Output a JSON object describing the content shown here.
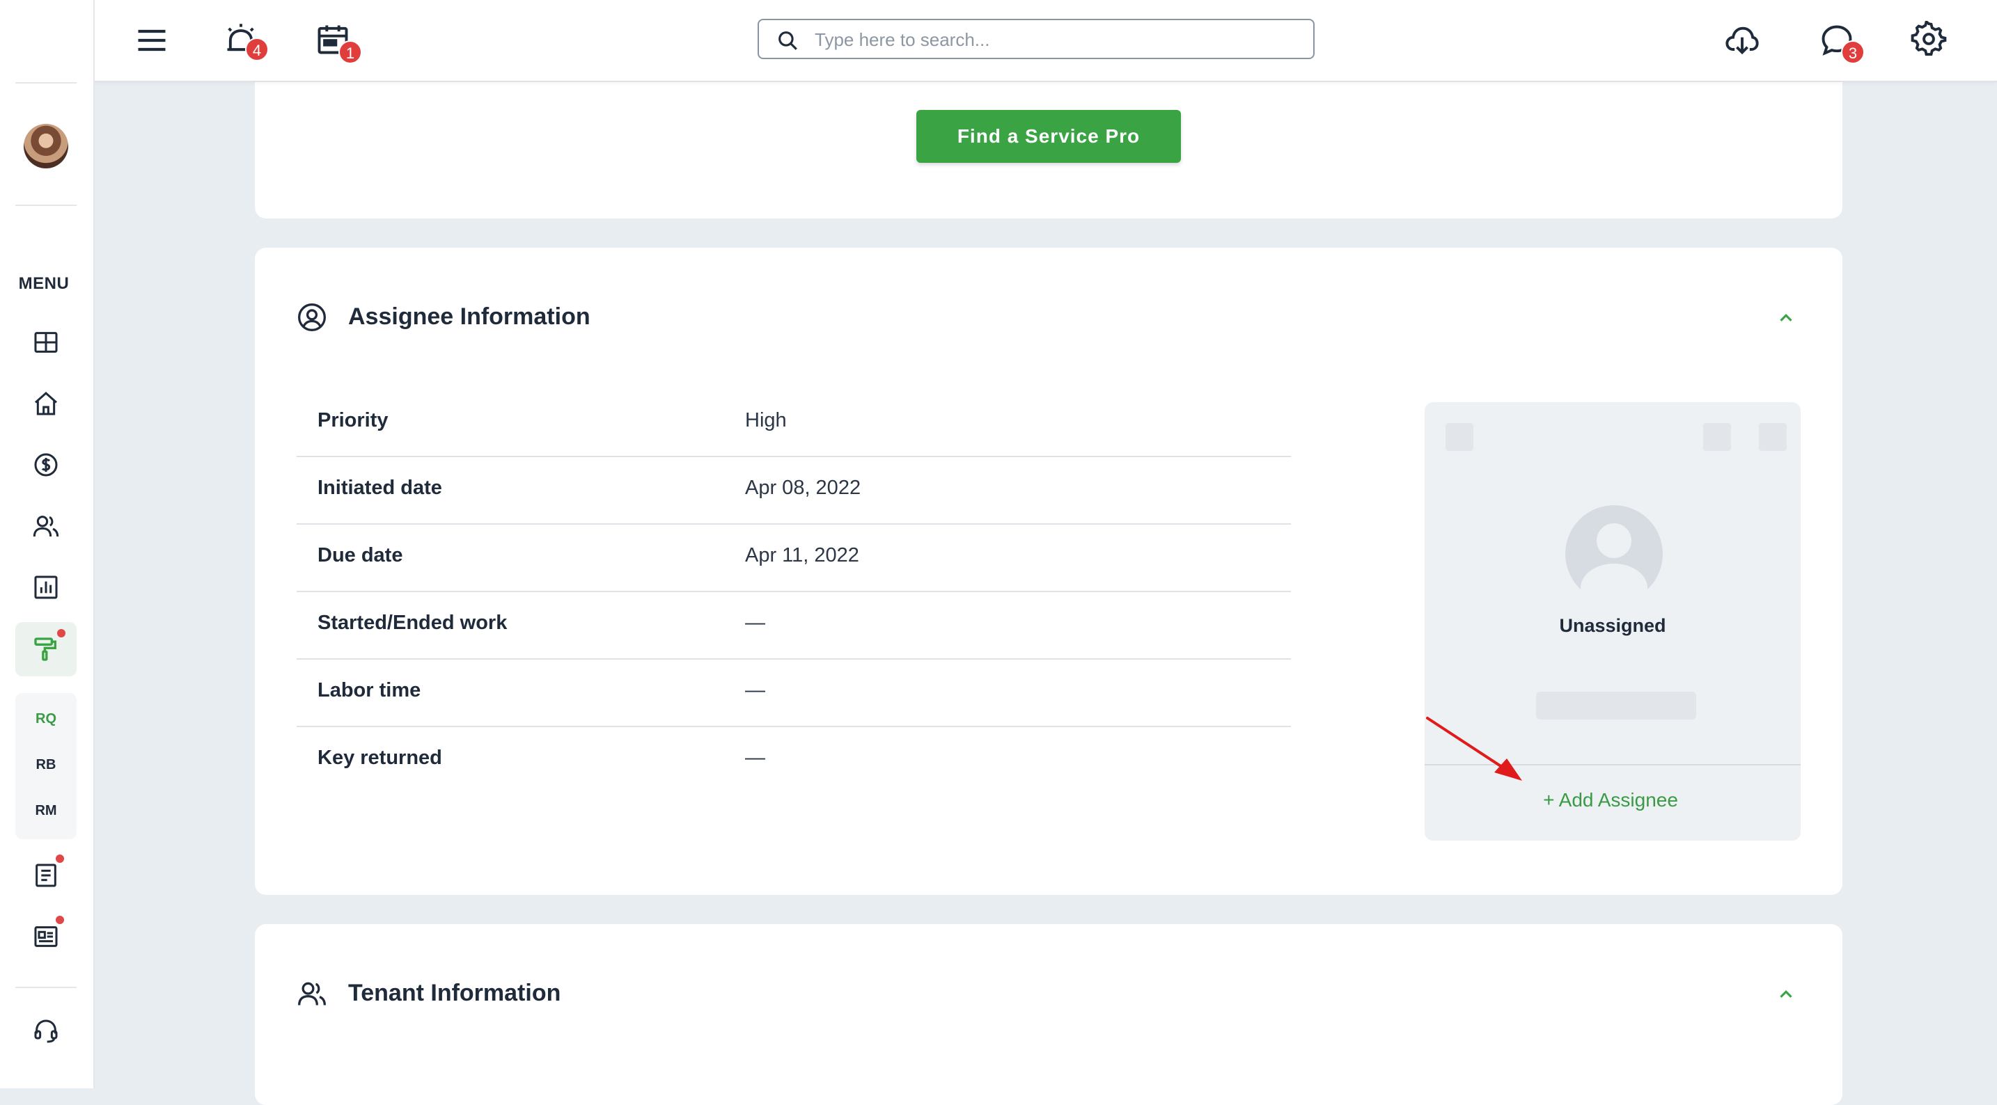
{
  "sidebar": {
    "menu_label": "MENU",
    "nav_items": [
      {
        "icon": "dashboard-icon"
      },
      {
        "icon": "home-icon"
      },
      {
        "icon": "dollar-icon"
      },
      {
        "icon": "people-icon"
      },
      {
        "icon": "reports-icon"
      },
      {
        "icon": "maintenance-roller-icon",
        "active": true,
        "notification_dot": true
      },
      {
        "icon": "document-icon",
        "notification_dot": true
      },
      {
        "icon": "news-icon",
        "notification_dot": true
      },
      {
        "icon": "headset-support-icon"
      }
    ],
    "sub_items": [
      {
        "label": "RQ",
        "active": true
      },
      {
        "label": "RB"
      },
      {
        "label": "RM"
      }
    ]
  },
  "topbar": {
    "alarm_badge": "4",
    "calendar_badge": "1",
    "chat_badge": "3",
    "search": {
      "placeholder": "Type here to search...",
      "value": ""
    }
  },
  "service_card": {
    "button_label": "Find a Service Pro"
  },
  "assignee_section": {
    "title": "Assignee Information",
    "rows": [
      {
        "label": "Priority",
        "value": "High"
      },
      {
        "label": "Initiated date",
        "value": "Apr 08, 2022"
      },
      {
        "label": "Due date",
        "value": "Apr 11, 2022"
      },
      {
        "label": "Started/Ended work",
        "value": "—"
      },
      {
        "label": "Labor time",
        "value": "—"
      },
      {
        "label": "Key returned",
        "value": "—"
      }
    ],
    "assignee_card": {
      "status": "Unassigned",
      "add_label": "+ Add Assignee"
    }
  },
  "tenant_section": {
    "title": "Tenant Information"
  },
  "colors": {
    "accent_green": "#3aa445",
    "badge_red": "#e03d3d",
    "annotation_arrow": "#e01b1b"
  }
}
